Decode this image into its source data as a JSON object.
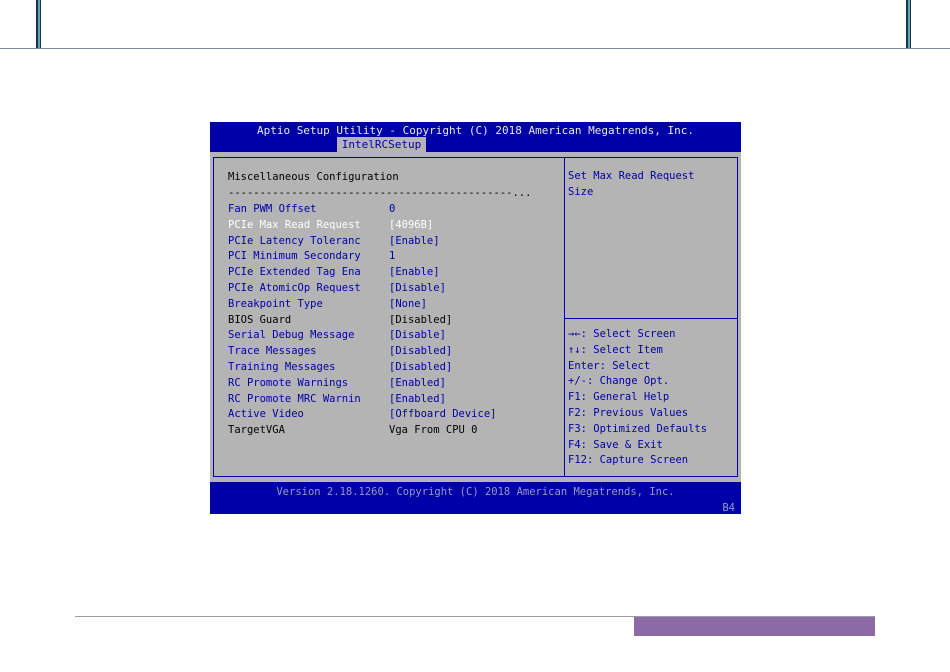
{
  "bios": {
    "title": "Aptio Setup Utility - Copyright (C) 2018 American Megatrends, Inc.",
    "active_tab": "IntelRCSetup",
    "section_title": "Miscellaneous Configuration",
    "separator": "---------------------------------------------...",
    "settings": [
      {
        "label": "Fan PWM Offset",
        "value": "0",
        "style": "link"
      },
      {
        "label": "PCIe Max Read Request",
        "value": "[4096B]",
        "style": "selected"
      },
      {
        "label": "PCIe Latency Toleranc",
        "value": "[Enable]",
        "style": "link"
      },
      {
        "label": "PCI Minimum Secondary",
        "value": "1",
        "style": "link"
      },
      {
        "label": "PCIe Extended Tag Ena",
        "value": "[Enable]",
        "style": "link"
      },
      {
        "label": "PCIe AtomicOp Request",
        "value": "[Disable]",
        "style": "link"
      },
      {
        "label": "Breakpoint Type",
        "value": "[None]",
        "style": "link"
      },
      {
        "label": "BIOS Guard",
        "value": "[Disabled]",
        "style": "fixed"
      },
      {
        "label": "Serial Debug Message",
        "value": "[Disable]",
        "style": "link"
      },
      {
        "label": "Trace Messages",
        "value": "[Disabled]",
        "style": "link"
      },
      {
        "label": "Training Messages",
        "value": "[Disabled]",
        "style": "link"
      },
      {
        "label": "RC Promote Warnings",
        "value": "[Enabled]",
        "style": "link"
      },
      {
        "label": "RC Promote MRC Warnin",
        "value": "[Enabled]",
        "style": "link"
      },
      {
        "label": "Active Video",
        "value": "[Offboard Device]",
        "style": "link"
      },
      {
        "label": "TargetVGA",
        "value": "Vga From CPU 0",
        "style": "fixed"
      }
    ],
    "help_text": "Set Max Read Request\nSize",
    "keys": [
      "→←: Select Screen",
      "↑↓: Select Item",
      "Enter: Select",
      "+/-: Change Opt.",
      "F1: General Help",
      "F2: Previous Values",
      "F3: Optimized Defaults",
      "F4: Save & Exit",
      "F12: Capture Screen"
    ],
    "footer": "Version 2.18.1260. Copyright (C) 2018 American Megatrends, Inc.",
    "code": "B4"
  },
  "colors": {
    "bios_blue": "#0000a8",
    "bios_gray": "#b4b4b4",
    "page_footer_bar": "#8c6aa8",
    "header_tab": "#5fa6bd"
  }
}
